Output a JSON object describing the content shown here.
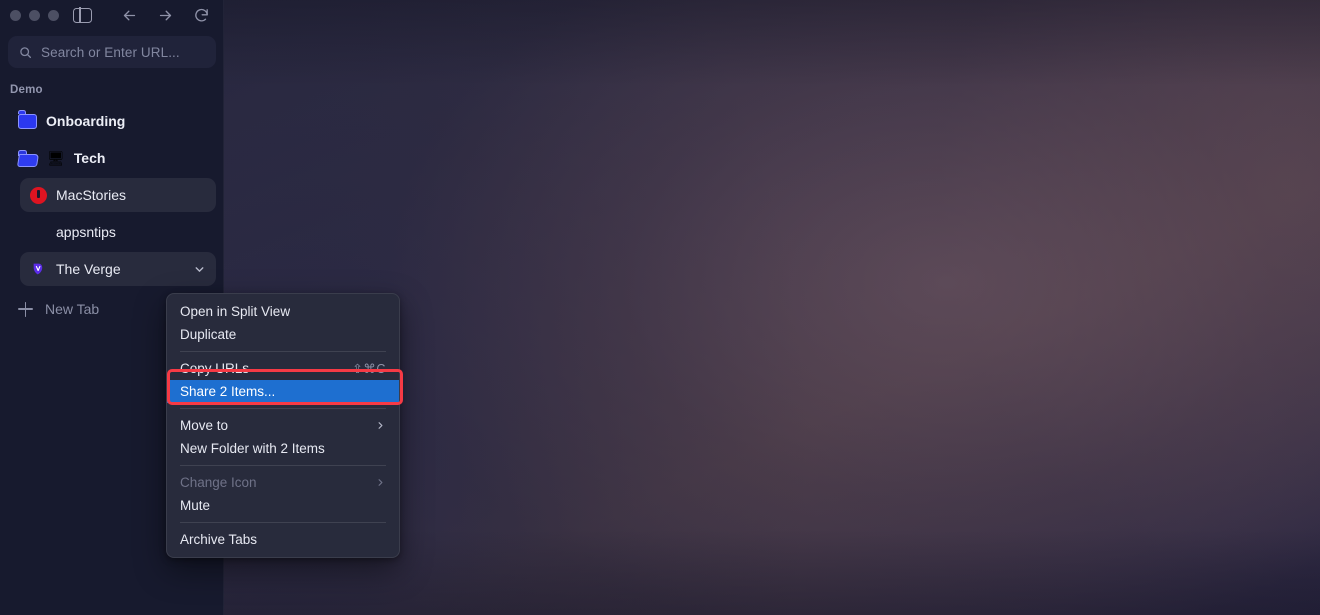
{
  "window": {
    "traffic_lights": [
      "close",
      "minimize",
      "zoom"
    ],
    "sidebar_toggle_icon": "sidebar-toggle-icon",
    "nav": {
      "back_icon": "arrow-left-icon",
      "forward_icon": "arrow-right-icon",
      "reload_icon": "reload-icon"
    }
  },
  "search": {
    "icon": "search-icon",
    "placeholder": "Search or Enter URL..."
  },
  "sidebar": {
    "group_label": "Demo",
    "items": [
      {
        "label": "Onboarding",
        "icon": "folder-closed-icon",
        "emoji": "",
        "type": "folder",
        "state": "normal"
      },
      {
        "label": "Tech",
        "icon": "folder-open-icon",
        "emoji": "🖥",
        "type": "folder",
        "state": "expanded"
      },
      {
        "label": "MacStories",
        "icon": "favicon-macstories",
        "type": "tab",
        "state": "selected"
      },
      {
        "label": "appsntips",
        "icon": "favicon-appsntips",
        "type": "tab",
        "state": "normal"
      },
      {
        "label": "The Verge",
        "icon": "favicon-verge",
        "type": "tab",
        "state": "selected",
        "chevron": "chevron-down-icon"
      }
    ],
    "new_tab": {
      "label": "New Tab",
      "icon": "plus-icon"
    }
  },
  "context_menu": {
    "items": [
      {
        "label": "Open in Split View",
        "type": "item"
      },
      {
        "label": "Duplicate",
        "type": "item"
      },
      {
        "type": "separator"
      },
      {
        "label": "Copy URLs",
        "type": "item",
        "shortcut": "⇧⌘C"
      },
      {
        "label": "Share 2 Items...",
        "type": "item",
        "state": "highlight"
      },
      {
        "type": "separator"
      },
      {
        "label": "Move to",
        "type": "submenu",
        "arrow": "chevron-right-icon"
      },
      {
        "label": "New Folder with 2 Items",
        "type": "item"
      },
      {
        "type": "separator"
      },
      {
        "label": "Change Icon",
        "type": "submenu",
        "state": "disabled",
        "arrow": "chevron-right-icon"
      },
      {
        "label": "Mute",
        "type": "item"
      },
      {
        "type": "separator"
      },
      {
        "label": "Archive Tabs",
        "type": "item"
      }
    ]
  },
  "annotation": {
    "name": "highlight-box",
    "color": "#f63a45"
  },
  "colors": {
    "sidebar_bg": "#171a2e",
    "menu_bg": "#282b3c",
    "highlight_blue": "#1e6fd0",
    "annotation_red": "#f63a45",
    "folder_blue": "#2b38ef",
    "macstories_red": "#de1421",
    "verge_purple": "#5c2ce8"
  }
}
